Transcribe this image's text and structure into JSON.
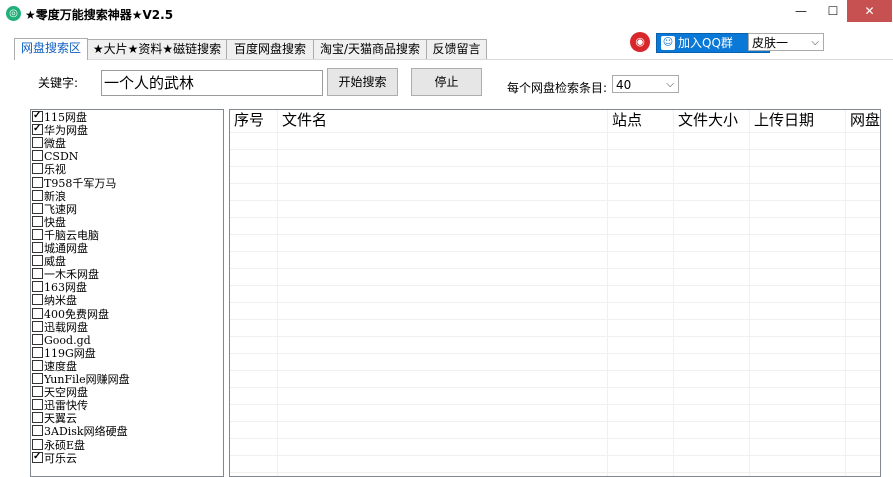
{
  "window": {
    "title": "★零度万能搜索神器★V2.5",
    "app_icon": "app-icon",
    "minimize": "—",
    "maximize": "☐",
    "close": "✕"
  },
  "tabs": [
    {
      "label": "网盘搜索区",
      "active": true
    },
    {
      "label": "★大片★资料★磁链搜索",
      "active": false
    },
    {
      "label": "百度网盘搜索",
      "active": false
    },
    {
      "label": "淘宝/天猫商品搜索",
      "active": false
    },
    {
      "label": "反馈留言",
      "active": false
    }
  ],
  "header": {
    "qq_join_label": "加入QQ群",
    "skin_value": "皮肤一"
  },
  "search": {
    "keyword_label": "关键字:",
    "keyword_value": "一个人的武林",
    "start_label": "开始搜索",
    "stop_label": "停止",
    "count_label": "每个网盘检索条目:",
    "count_value": "40"
  },
  "sites": [
    {
      "label": "115网盘",
      "checked": true
    },
    {
      "label": "华为网盘",
      "checked": true
    },
    {
      "label": "微盘",
      "checked": false
    },
    {
      "label": "CSDN",
      "checked": false
    },
    {
      "label": "乐视",
      "checked": false
    },
    {
      "label": "T958千军万马",
      "checked": false
    },
    {
      "label": "新浪",
      "checked": false
    },
    {
      "label": "飞速网",
      "checked": false
    },
    {
      "label": "快盘",
      "checked": false
    },
    {
      "label": "千脑云电脑",
      "checked": false
    },
    {
      "label": "城通网盘",
      "checked": false
    },
    {
      "label": "威盘",
      "checked": false
    },
    {
      "label": "一木禾网盘",
      "checked": false
    },
    {
      "label": "163网盘",
      "checked": false
    },
    {
      "label": "纳米盘",
      "checked": false
    },
    {
      "label": "400免费网盘",
      "checked": false
    },
    {
      "label": "迅载网盘",
      "checked": false
    },
    {
      "label": "Good.gd",
      "checked": false
    },
    {
      "label": "119G网盘",
      "checked": false
    },
    {
      "label": "速度盘",
      "checked": false
    },
    {
      "label": "YunFile网赚网盘",
      "checked": false
    },
    {
      "label": "天空网盘",
      "checked": false
    },
    {
      "label": "迅雷快传",
      "checked": false
    },
    {
      "label": "天翼云",
      "checked": false
    },
    {
      "label": "3ADisk网络硬盘",
      "checked": false
    },
    {
      "label": "永硕E盘",
      "checked": false
    },
    {
      "label": "可乐云",
      "checked": true
    }
  ],
  "grid": {
    "columns": [
      "序号",
      "文件名",
      "站点",
      "文件大小",
      "上传日期",
      "网盘"
    ]
  },
  "colors": {
    "accent": "#0a78d6",
    "close": "#c75050",
    "active_tab_text": "#1060c0"
  }
}
